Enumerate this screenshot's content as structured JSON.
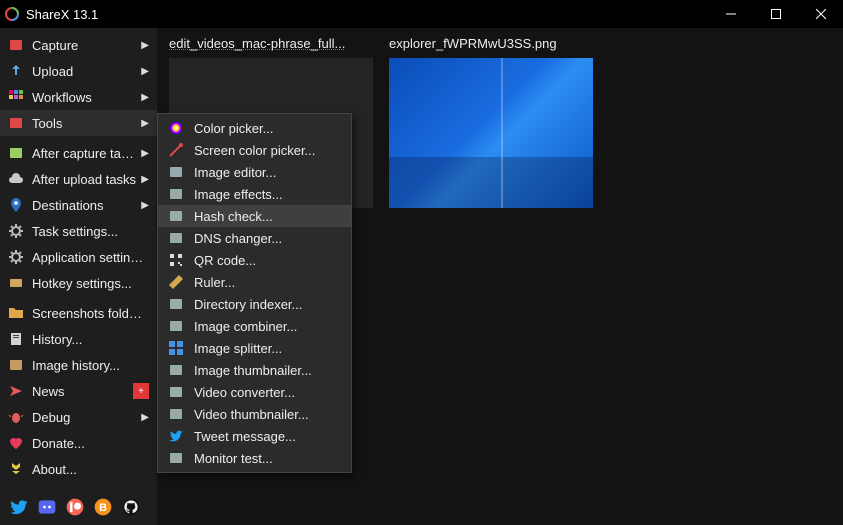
{
  "title": "ShareX 13.1",
  "sidebar": {
    "items": [
      {
        "label": "Capture",
        "icon": "capture",
        "sub": true
      },
      {
        "label": "Upload",
        "icon": "upload",
        "sub": true
      },
      {
        "label": "Workflows",
        "icon": "workflows",
        "sub": true
      },
      {
        "label": "Tools",
        "icon": "tools",
        "sub": true,
        "highlight": true
      },
      {
        "label": "After capture tasks",
        "icon": "after-capture",
        "sub": true,
        "group": true
      },
      {
        "label": "After upload tasks",
        "icon": "after-upload",
        "sub": true
      },
      {
        "label": "Destinations",
        "icon": "destinations",
        "sub": true
      },
      {
        "label": "Task settings...",
        "icon": "task-settings"
      },
      {
        "label": "Application settings...",
        "icon": "app-settings"
      },
      {
        "label": "Hotkey settings...",
        "icon": "hotkey-settings"
      },
      {
        "label": "Screenshots folder...",
        "icon": "folder",
        "group": true
      },
      {
        "label": "History...",
        "icon": "history"
      },
      {
        "label": "Image history...",
        "icon": "image-history"
      },
      {
        "label": "News",
        "icon": "news",
        "badge": "+"
      },
      {
        "label": "Debug",
        "icon": "debug",
        "sub": true
      },
      {
        "label": "Donate...",
        "icon": "donate"
      },
      {
        "label": "About...",
        "icon": "about"
      }
    ]
  },
  "submenu": {
    "items": [
      {
        "label": "Color picker...",
        "icon": "color-picker"
      },
      {
        "label": "Screen color picker...",
        "icon": "screen-picker"
      },
      {
        "label": "Image editor...",
        "icon": "image-editor"
      },
      {
        "label": "Image effects...",
        "icon": "image-effects"
      },
      {
        "label": "Hash check...",
        "icon": "hash-check",
        "highlight": true
      },
      {
        "label": "DNS changer...",
        "icon": "dns"
      },
      {
        "label": "QR code...",
        "icon": "qr"
      },
      {
        "label": "Ruler...",
        "icon": "ruler"
      },
      {
        "label": "Directory indexer...",
        "icon": "dir-index"
      },
      {
        "label": "Image combiner...",
        "icon": "img-combine"
      },
      {
        "label": "Image splitter...",
        "icon": "img-split"
      },
      {
        "label": "Image thumbnailer...",
        "icon": "img-thumb"
      },
      {
        "label": "Video converter...",
        "icon": "vid-conv"
      },
      {
        "label": "Video thumbnailer...",
        "icon": "vid-thumb"
      },
      {
        "label": "Tweet message...",
        "icon": "tweet"
      },
      {
        "label": "Monitor test...",
        "icon": "monitor"
      }
    ]
  },
  "thumbs": [
    {
      "title": "edit_videos_mac-phrase_full..."
    },
    {
      "title": "explorer_fWPRMwU3SS.png"
    }
  ],
  "icon_colors": {
    "capture": "#e04848",
    "upload": "#59a7e6",
    "workflows": "#ffd24f",
    "tools": "#e04848",
    "after-capture": "#9ad05d",
    "after-upload": "#c8c8c8",
    "destinations": "#2f6fc5",
    "task-settings": "#bfbfbf",
    "app-settings": "#bfbfbf",
    "hotkey-settings": "#cfa85d",
    "folder": "#e0a84a",
    "history": "#d2d2d2",
    "image-history": "#c49a62",
    "news": "#e45b5b",
    "debug": "#e45b5b",
    "donate": "#e43b5b",
    "about": "#e3c84b"
  }
}
